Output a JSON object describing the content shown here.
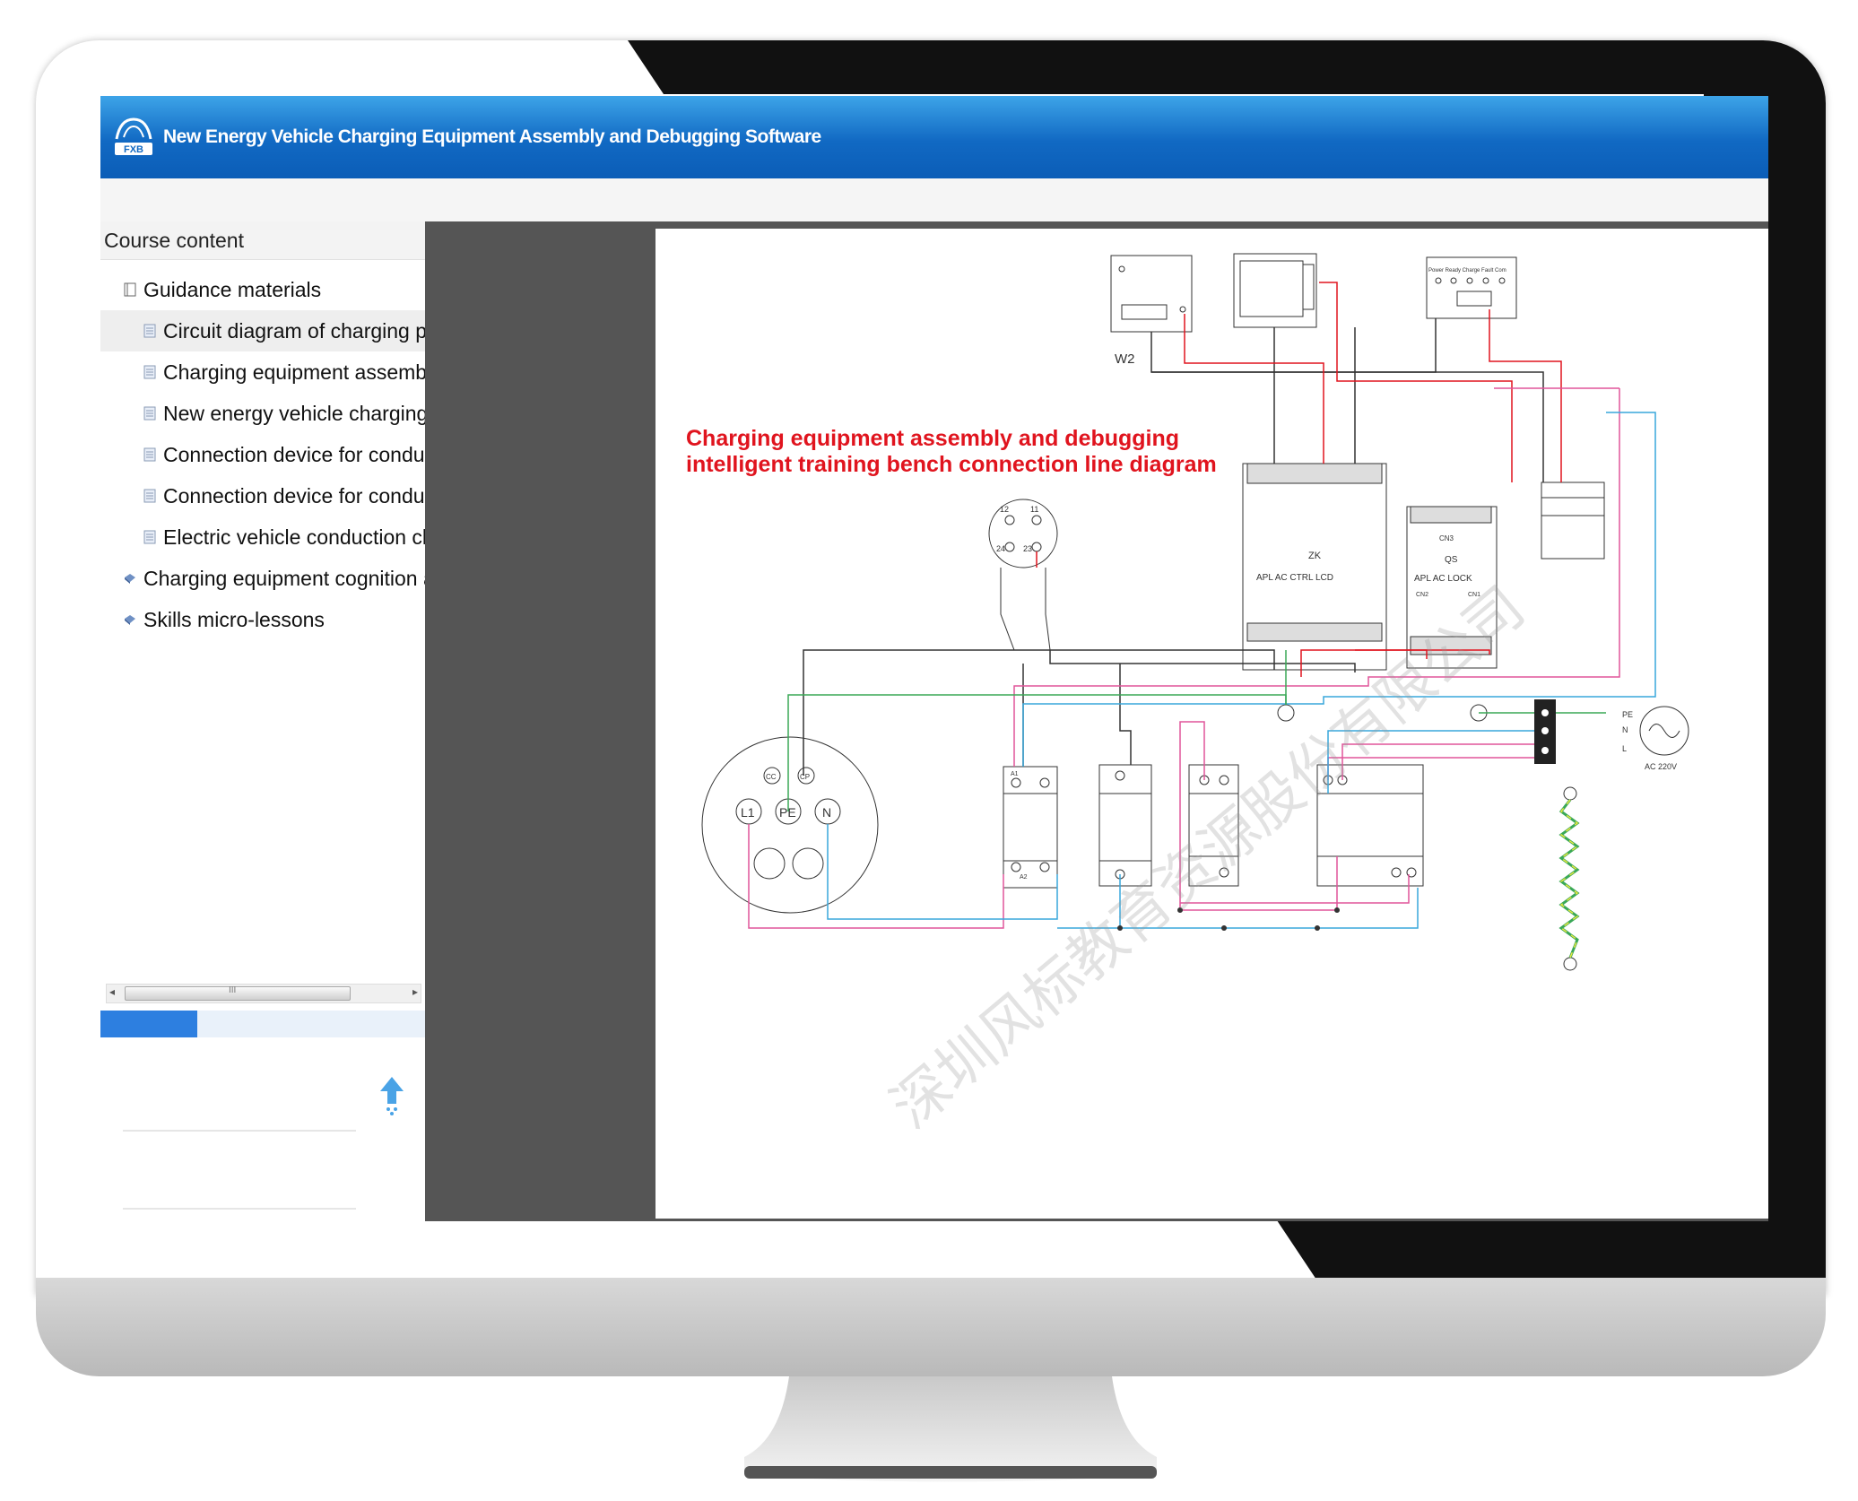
{
  "app": {
    "title": "New Energy Vehicle Charging Equipment Assembly and Debugging Software",
    "logo_text": "FXB"
  },
  "sidebar": {
    "heading": "Course content",
    "items": [
      {
        "label": "Guidance materials",
        "level": 0,
        "icon": "book-icon"
      },
      {
        "label": "Circuit diagram of charging pi",
        "level": 1,
        "icon": "document-icon",
        "selected": true
      },
      {
        "label": "Charging equipment assembly",
        "level": 1,
        "icon": "document-icon"
      },
      {
        "label": "New energy vehicle charging e",
        "level": 1,
        "icon": "document-icon"
      },
      {
        "label": "Connection device for conduc",
        "level": 1,
        "icon": "document-icon"
      },
      {
        "label": "Connection device for conduc",
        "level": 1,
        "icon": "document-icon"
      },
      {
        "label": "Electric vehicle conduction ch",
        "level": 1,
        "icon": "document-icon"
      },
      {
        "label": "Charging equipment cognition a",
        "level": 0,
        "icon": "gem-icon"
      },
      {
        "label": "Skills micro-lessons",
        "level": 0,
        "icon": "gem-icon"
      }
    ],
    "scrollbar_grip": "III"
  },
  "diagram": {
    "title_line1": "Charging equipment assembly and debugging",
    "title_line2": "intelligent training bench connection line diagram",
    "labels": {
      "w2": "W2",
      "zk": "ZK",
      "zk_ports": "APL  AC  CTRL  LCD",
      "qs": "QS",
      "qs_ports": "APL  AC  LOCK",
      "cn3": "CN3",
      "cn2": "CN2",
      "cn1": "CN1",
      "pe": "PE",
      "n": "N",
      "l": "L",
      "ac": "AC 220V",
      "l1": "L1",
      "pe_plug": "PE",
      "n_plug": "N",
      "cc": "CC",
      "cp": "CP",
      "pin12": "12",
      "pin11": "11",
      "pin24": "24",
      "pin23": "23",
      "a1": "A1",
      "a2": "A2",
      "indicators": "Power  Ready  Charge  Fault  Com"
    }
  },
  "watermark": "深圳风标教育资源股份有限公司",
  "colors": {
    "titlebar": "#1169c3",
    "wire_red": "#e0141e",
    "wire_pink": "#e0559a",
    "wire_blue": "#39a7dc",
    "wire_green": "#3aa857",
    "wire_black": "#333333",
    "progress": "#2d7fe0"
  }
}
